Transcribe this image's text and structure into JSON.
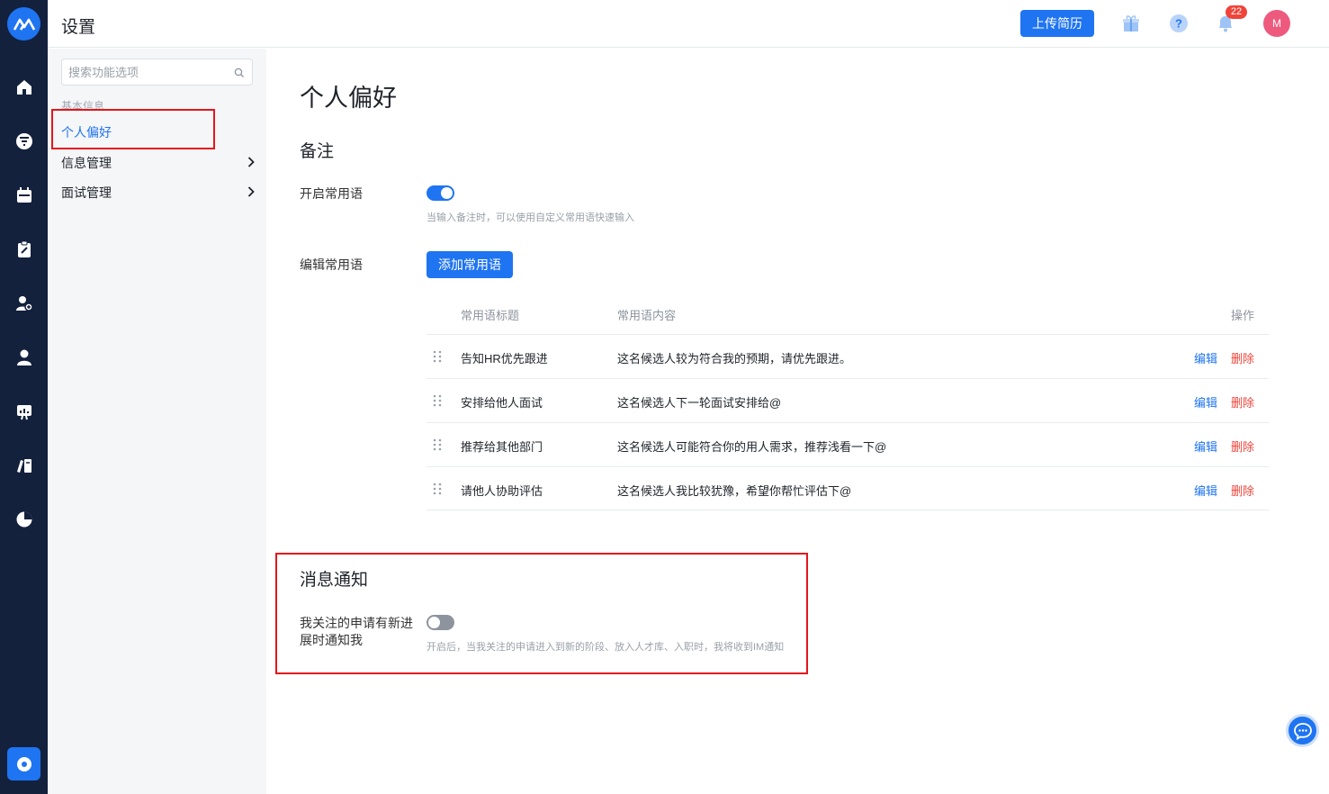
{
  "header": {
    "title": "设置",
    "upload_label": "上传简历",
    "notification_count": "22",
    "avatar_initial": "M"
  },
  "rail": {
    "items": [
      "home-icon",
      "filter-icon",
      "calendar-icon",
      "clipboard-icon",
      "user-add-icon",
      "user-icon",
      "presentation-icon",
      "books-icon",
      "pie-chart-icon"
    ],
    "settings_icon": "settings-icon"
  },
  "sidebar": {
    "search_placeholder": "搜索功能选项",
    "group_label": "基本信息",
    "items": [
      {
        "label": "个人偏好",
        "active": true
      },
      {
        "label": "信息管理",
        "has_submenu": true
      },
      {
        "label": "面试管理",
        "has_submenu": true
      }
    ]
  },
  "main": {
    "title": "个人偏好",
    "notes": {
      "section_title": "备注",
      "enable_label": "开启常用语",
      "enable_on": true,
      "enable_hint": "当输入备注时，可以使用自定义常用语快速输入",
      "edit_label": "编辑常用语",
      "add_button": "添加常用语",
      "table": {
        "headers": [
          "常用语标题",
          "常用语内容",
          "操作"
        ],
        "rows": [
          {
            "title": "告知HR优先跟进",
            "content": "这名候选人较为符合我的预期，请优先跟进。"
          },
          {
            "title": "安排给他人面试",
            "content": "这名候选人下一轮面试安排给@"
          },
          {
            "title": "推荐给其他部门",
            "content": "这名候选人可能符合你的用人需求，推荐浅看一下@"
          },
          {
            "title": "请他人协助评估",
            "content": "这名候选人我比较犹豫，希望你帮忙评估下@"
          }
        ],
        "edit_label": "编辑",
        "delete_label": "删除"
      }
    },
    "notify": {
      "section_title": "消息通知",
      "label_line1": "我关注的申请有新进",
      "label_line2": "展时通知我",
      "toggle_on": false,
      "hint": "开启后，当我关注的申请进入到新的阶段、放入人才库、入职时，我将收到IM通知"
    }
  },
  "colors": {
    "accent": "#1f74f1",
    "rail_bg": "#13213d",
    "danger": "#f0443a",
    "highlight": "#e3161b"
  }
}
